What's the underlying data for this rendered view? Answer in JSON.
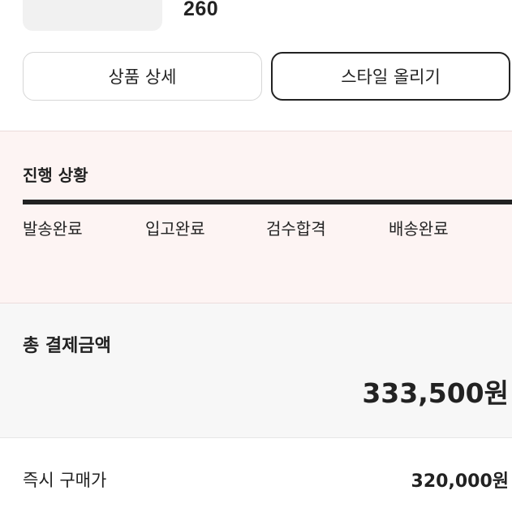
{
  "product": {
    "size": "260"
  },
  "actions": {
    "detail_label": "상품 상세",
    "style_label": "스타일 올리기"
  },
  "progress": {
    "title": "진행 상황",
    "completed_fraction": 1.0,
    "steps": [
      "발송완료",
      "입고완료",
      "검수합격",
      "배송완료"
    ]
  },
  "payment": {
    "total_label": "총 결제금액",
    "total_amount": "333,500원",
    "instant_label": "즉시 구매가",
    "instant_value": "320,000원"
  },
  "colors": {
    "progress_bg": "#fdf4f3",
    "progress_bar": "#222222",
    "total_bg": "#f7f7f7"
  }
}
